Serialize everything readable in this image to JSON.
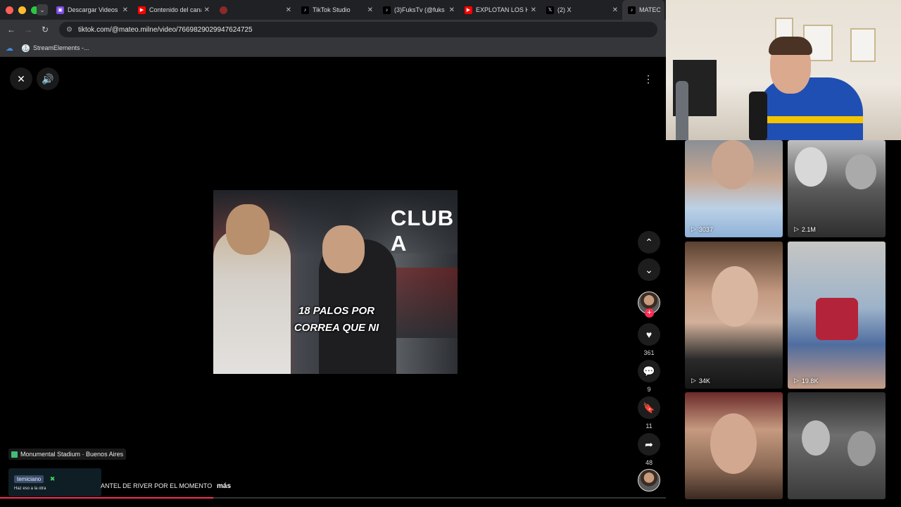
{
  "browser": {
    "tabs": [
      {
        "label": "Descargar Videos",
        "icon": "download-site-icon",
        "color": "#7b4ae2",
        "active": false
      },
      {
        "label": "Contenido del canal",
        "icon": "youtube-icon",
        "color": "#ff0000",
        "active": false
      },
      {
        "label": "",
        "icon": "loading-icon",
        "color": "#8a2a2a",
        "active": false
      },
      {
        "label": "TikTok Studio",
        "icon": "tiktok-icon",
        "color": "#000000",
        "active": false
      },
      {
        "label": "(3)FuksTv (@fuks",
        "icon": "tiktok-icon",
        "color": "#000000",
        "active": false
      },
      {
        "label": "EXPLOTAN LOS H",
        "icon": "youtube-icon",
        "color": "#ff0000",
        "active": false
      },
      {
        "label": "(2) X",
        "icon": "x-icon",
        "color": "#000000",
        "active": false
      },
      {
        "label": "MATEO MIL",
        "icon": "tiktok-icon",
        "color": "#000000",
        "active": true
      }
    ],
    "url": "tiktok.com/@mateo.milne/video/7669829029947624725",
    "bookmarks": [
      {
        "label": "StreamElements -...",
        "icon": "streamelements-icon"
      }
    ]
  },
  "video": {
    "club_text": "CLUB A",
    "caption_line1": "18 PALOS POR",
    "caption_line2": "CORREA QUE NI",
    "progress_percent": 32
  },
  "actions": {
    "likes": "361",
    "comments": "9",
    "saves": "11",
    "shares": "48"
  },
  "post": {
    "location": "Monumental Stadium · Buenos Aires",
    "description": "ANTEL DE RIVER POR EL MOMENTO",
    "more_label": "más"
  },
  "chat_overlay": {
    "username": "temiciano",
    "message": "Haz eso a la otra"
  },
  "related": [
    {
      "views": "3037"
    },
    {
      "views": "2.1M"
    },
    {
      "views": "34K"
    },
    {
      "views": "19.8K"
    },
    {
      "views": ""
    },
    {
      "views": ""
    }
  ]
}
